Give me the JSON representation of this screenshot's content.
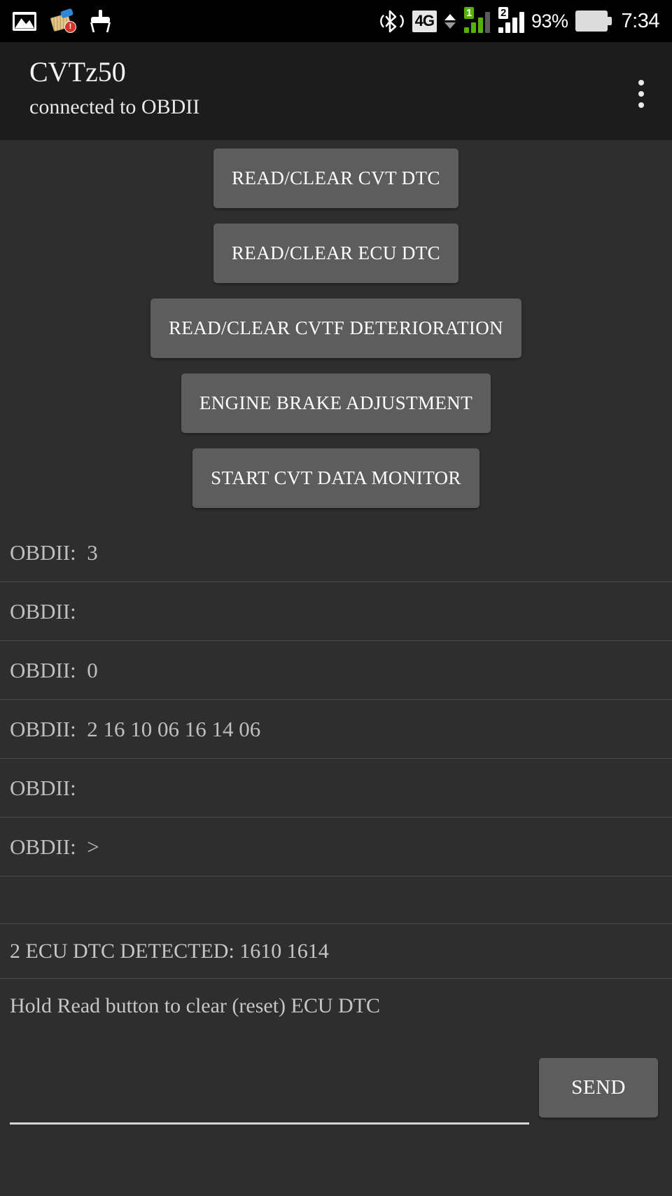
{
  "status_bar": {
    "left_icons": [
      {
        "name": "photo-icon",
        "label": "photo"
      },
      {
        "name": "broom-alert-icon",
        "label": "cleaner-alert",
        "badge": "!"
      },
      {
        "name": "broom-icon",
        "label": "cleaner"
      }
    ],
    "bluetooth_icon": "bluetooth-icon",
    "network_type": "4G",
    "sim1_label": "1",
    "sim2_label": "2",
    "battery_percent": "93%",
    "clock": "7:34"
  },
  "appbar": {
    "title": "CVTz50",
    "subtitle": "connected to OBDII",
    "overflow_label": "more-options"
  },
  "buttons": [
    {
      "label": "READ/CLEAR CVT DTC",
      "name": "read-clear-cvt-dtc-button"
    },
    {
      "label": "READ/CLEAR ECU DTC",
      "name": "read-clear-ecu-dtc-button"
    },
    {
      "label": "READ/CLEAR CVTF DETERIORATION",
      "name": "read-clear-cvtf-deterioration-button"
    },
    {
      "label": "ENGINE BRAKE ADJUSTMENT",
      "name": "engine-brake-adjustment-button"
    },
    {
      "label": "START CVT DATA MONITOR",
      "name": "start-cvt-data-monitor-button"
    }
  ],
  "log": [
    {
      "text": "OBDII:  3"
    },
    {
      "text": "OBDII:"
    },
    {
      "text": "OBDII:  0"
    },
    {
      "text": "OBDII:  2 16 10 06 16 14 06"
    },
    {
      "text": "OBDII:"
    },
    {
      "text": "OBDII:  >"
    },
    {
      "text": ""
    }
  ],
  "messages": [
    {
      "text": "2 ECU DTC DETECTED: 1610 1614"
    },
    {
      "text": "Hold Read button to clear (reset) ECU DTC"
    }
  ],
  "composer": {
    "input_value": "",
    "input_placeholder": "",
    "send_label": "SEND"
  },
  "colors": {
    "background": "#2e2e2e",
    "appbar": "#1c1c1c",
    "button": "#5d5d5d",
    "divider": "#4a4a4a",
    "text": "#bfbfbf",
    "signal_green": "#56b200",
    "badge_red": "#d8332b"
  }
}
